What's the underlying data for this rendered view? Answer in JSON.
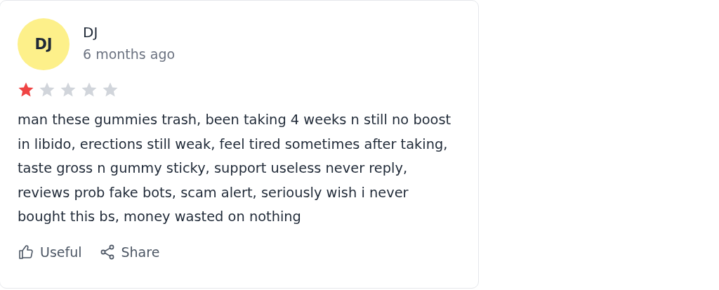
{
  "review": {
    "avatar_initials": "DJ",
    "author": "DJ",
    "time": "6 months ago",
    "stars": 1,
    "text": "man these gummies trash, been taking 4 weeks n still no boost in libido, erections still weak, feel tired sometimes after taking, taste gross n gummy sticky, support useless never reply, reviews prob fake bots, scam alert, seriously wish i never bought this bs, money wasted on nothing",
    "actions": [
      {
        "kind": "useful",
        "label": "Useful"
      },
      {
        "kind": "share",
        "label": "Share"
      }
    ]
  }
}
